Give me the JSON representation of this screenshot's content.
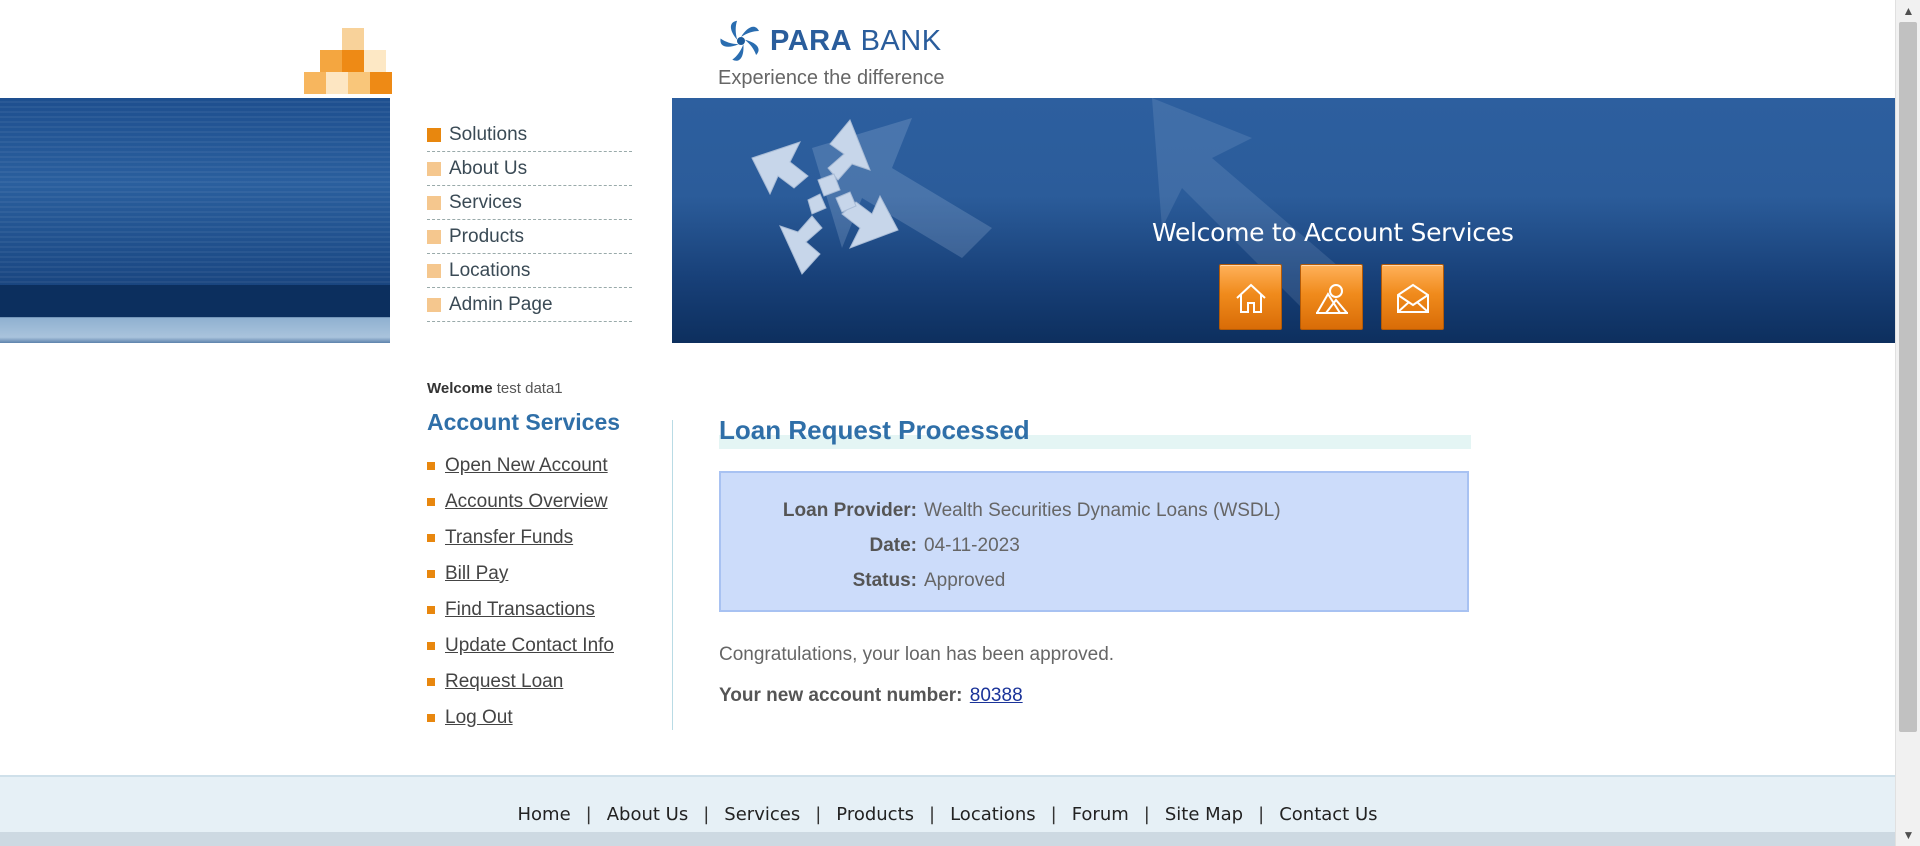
{
  "brand": {
    "name_bold": "PARA",
    "name_light": " BANK",
    "tagline": "Experience the difference"
  },
  "top_menu": [
    {
      "label": "Solutions",
      "active": true
    },
    {
      "label": "About Us"
    },
    {
      "label": "Services"
    },
    {
      "label": "Products"
    },
    {
      "label": "Locations"
    },
    {
      "label": "Admin Page"
    }
  ],
  "banner": {
    "title": "Welcome to Account Services",
    "buttons": [
      "home-icon",
      "about-icon",
      "contact-icon"
    ]
  },
  "sidebar": {
    "welcome_label": "Welcome",
    "user_name": "test data1",
    "title": "Account Services",
    "links": [
      "Open New Account",
      "Accounts Overview",
      "Transfer Funds",
      "Bill Pay",
      "Find Transactions",
      "Update Contact Info",
      "Request Loan",
      "Log Out"
    ]
  },
  "main": {
    "title": "Loan Request Processed",
    "details": [
      {
        "label": "Loan Provider:",
        "value": "Wealth Securities Dynamic Loans (WSDL)"
      },
      {
        "label": "Date:",
        "value": "04-11-2023"
      },
      {
        "label": "Status:",
        "value": "Approved"
      }
    ],
    "message": "Congratulations, your loan has been approved.",
    "new_account_label": "Your new account number:",
    "new_account_number": "80388"
  },
  "footer": {
    "links": [
      "Home",
      "About Us",
      "Services",
      "Products",
      "Locations",
      "Forum",
      "Site Map",
      "Contact Us"
    ],
    "separator": "|"
  },
  "colors": {
    "accent_orange": "#e8870e",
    "title_blue": "#2f6fa8",
    "banner_blue": "#1e4f8f",
    "info_box": "#ccdcfa"
  }
}
